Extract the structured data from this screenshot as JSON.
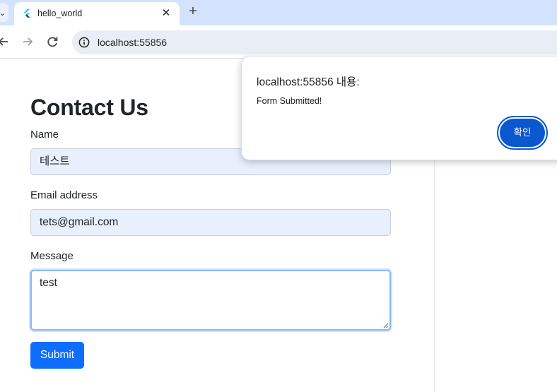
{
  "browser": {
    "tab_title": "hello_world",
    "close_glyph": "✕",
    "newtab_glyph": "+",
    "url": "localhost:55856",
    "icons": {
      "back": "arrow-left-icon",
      "forward": "arrow-right-icon",
      "reload": "reload-icon",
      "site_info": "site-info-icon",
      "favicon": "flutter-logo-icon"
    }
  },
  "form": {
    "heading": "Contact Us",
    "name_label": "Name",
    "name_value": "테스트",
    "email_label": "Email address",
    "email_value": "tets@gmail.com",
    "message_label": "Message",
    "message_value": "test",
    "submit_label": "Submit"
  },
  "dialog": {
    "title": "localhost:55856 내용:",
    "message": "Form Submitted!",
    "ok_label": "확인"
  },
  "colors": {
    "tabstrip": "#d3e3fd",
    "primary": "#0d6efd",
    "dialog_button": "#0b57d0",
    "autofill": "#e8f0fe"
  }
}
